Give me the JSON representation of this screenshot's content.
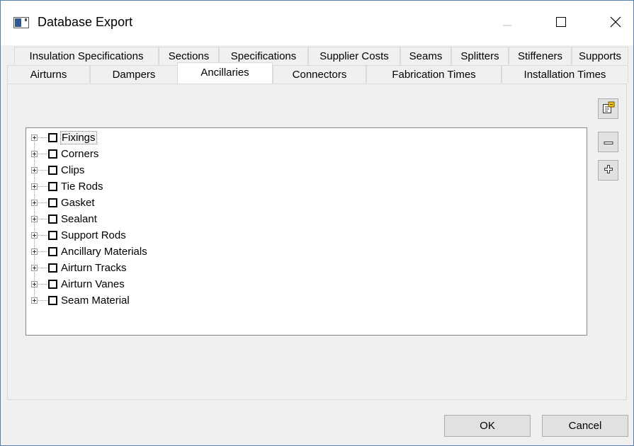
{
  "window": {
    "title": "Database Export",
    "icons": {
      "app": "window-app-icon",
      "minimize": "minimize-icon",
      "maximize": "maximize-icon",
      "close": "close-icon"
    }
  },
  "tabs": {
    "row1": [
      "Insulation Specifications",
      "Sections",
      "Specifications",
      "Supplier Costs",
      "Seams",
      "Splitters",
      "Stiffeners",
      "Supports"
    ],
    "row2": [
      "Airturns",
      "Dampers",
      "Ancillaries",
      "Connectors",
      "Fabrication Times",
      "Installation Times"
    ],
    "active": "Ancillaries"
  },
  "tree": {
    "items": [
      {
        "label": "Fixings",
        "selected": true,
        "checked": false
      },
      {
        "label": "Corners",
        "checked": false
      },
      {
        "label": "Clips",
        "checked": false
      },
      {
        "label": "Tie Rods",
        "checked": false
      },
      {
        "label": "Gasket",
        "checked": false
      },
      {
        "label": "Sealant",
        "checked": false
      },
      {
        "label": "Support Rods",
        "checked": false
      },
      {
        "label": "Ancillary Materials",
        "checked": false
      },
      {
        "label": "Airturn Tracks",
        "checked": false
      },
      {
        "label": "Airturn Vanes",
        "checked": false
      },
      {
        "label": "Seam Material",
        "checked": false
      }
    ]
  },
  "side_buttons": {
    "properties_icon": "properties-icon",
    "collapse_icon": "collapse-minus-icon",
    "expand_icon": "expand-plus-icon"
  },
  "buttons": {
    "ok": "OK",
    "cancel": "Cancel"
  }
}
